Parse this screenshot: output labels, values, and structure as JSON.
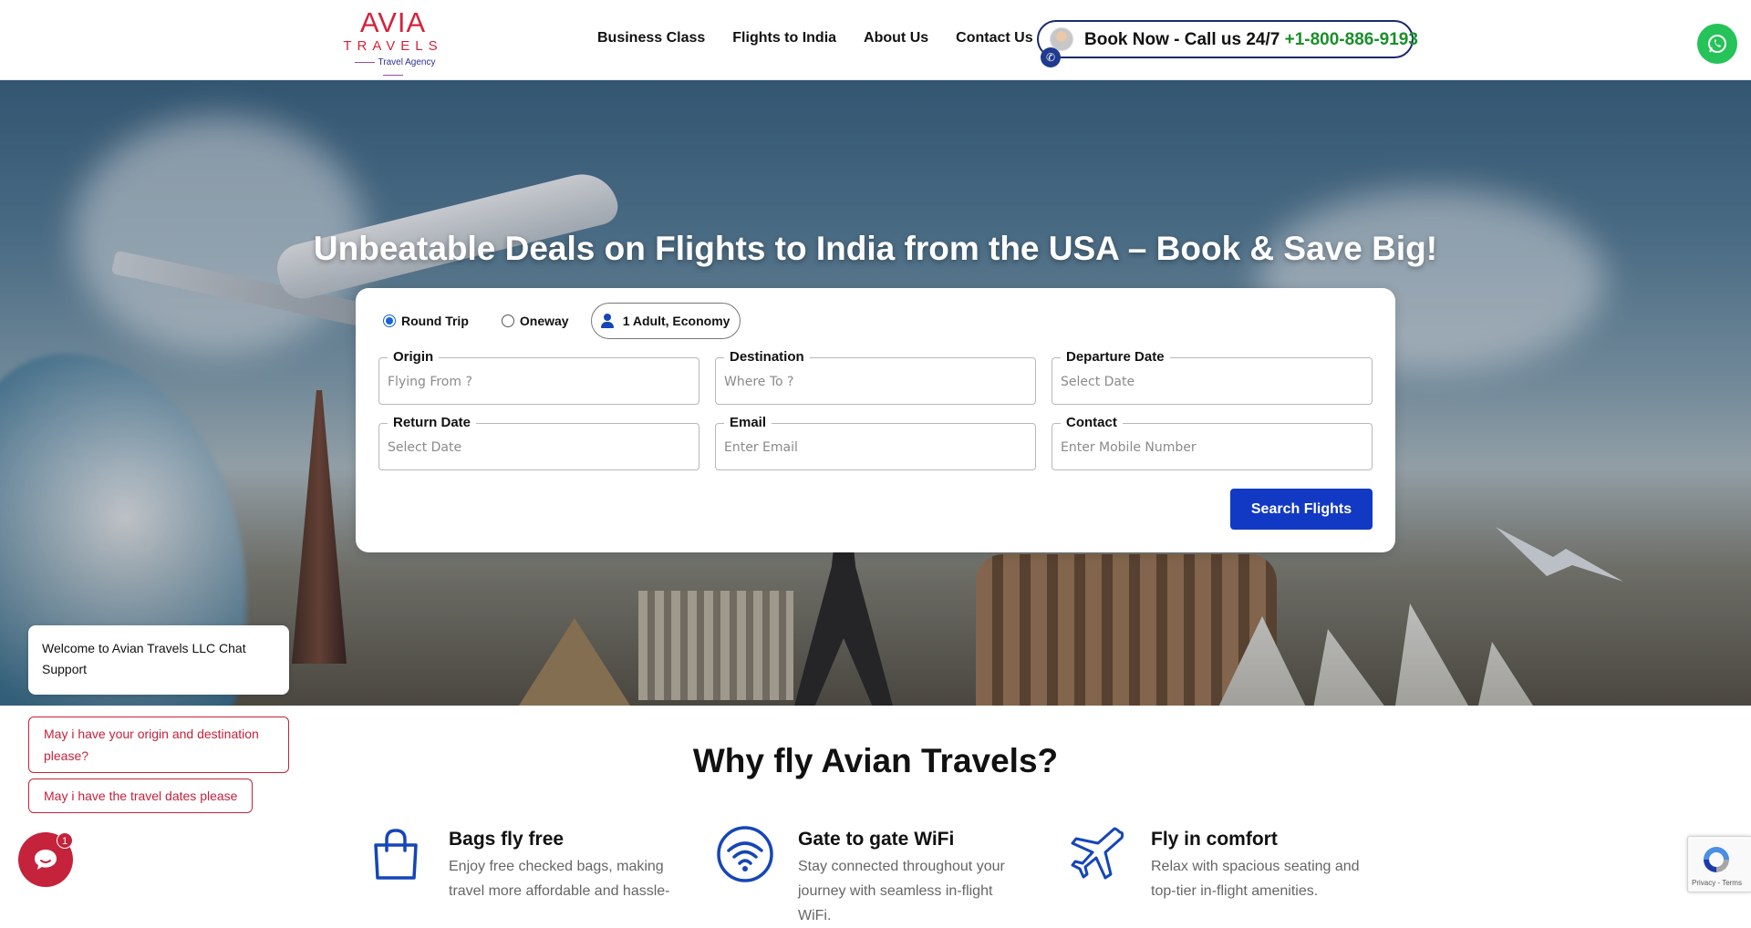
{
  "header": {
    "logo": {
      "line1": "AVIA",
      "line2": "TRAVELS",
      "line3": "Travel Agency"
    },
    "nav": [
      {
        "label": "Business Class"
      },
      {
        "label": "Flights to India"
      },
      {
        "label": "About Us"
      },
      {
        "label": "Contact Us"
      }
    ],
    "book_now": {
      "label": "Book Now - Call us 24/7",
      "phone": "+1-800-886-9193"
    },
    "whatsapp_icon": "whatsapp-icon",
    "colors": {
      "brand_red": "#d4233c",
      "brand_navy": "#1b2a6b",
      "phone_green": "#1a8f2a",
      "whatsapp_green": "#25c358"
    }
  },
  "hero": {
    "title": "Unbeatable Deals on Flights to India from the USA – Book & Save Big!"
  },
  "search": {
    "trip_types": [
      {
        "label": "Round Trip",
        "selected": true
      },
      {
        "label": "Oneway",
        "selected": false
      }
    ],
    "passengers": "1 Adult, Economy",
    "fields": {
      "origin": {
        "label": "Origin",
        "placeholder": "Flying From ?",
        "value": ""
      },
      "destination": {
        "label": "Destination",
        "placeholder": "Where To ?",
        "value": ""
      },
      "departure": {
        "label": "Departure Date",
        "placeholder": "Select Date",
        "value": ""
      },
      "return": {
        "label": "Return Date",
        "placeholder": "Select Date",
        "value": ""
      },
      "email": {
        "label": "Email",
        "placeholder": "Enter Email",
        "value": ""
      },
      "contact": {
        "label": "Contact",
        "placeholder": "Enter Mobile Number",
        "value": ""
      }
    },
    "submit_label": "Search Flights",
    "colors": {
      "accent": "#1239c4",
      "radio": "#1565d8"
    }
  },
  "why": {
    "title": "Why fly Avian Travels?",
    "features": [
      {
        "icon": "shopping-bag-icon",
        "title": "Bags fly free",
        "desc": "Enjoy free checked bags, making travel more affordable and hassle-"
      },
      {
        "icon": "wifi-icon",
        "title": "Gate to gate WiFi",
        "desc": "Stay connected throughout your journey with seamless in-flight WiFi."
      },
      {
        "icon": "airplane-icon",
        "title": "Fly in comfort",
        "desc": "Relax with spacious seating and top-tier in-flight amenities."
      }
    ]
  },
  "chat": {
    "welcome": "Welcome to Avian Travels LLC Chat Support",
    "suggestions": [
      "May i have your origin and destination please?",
      "May i have the travel dates please"
    ],
    "unread_count": "1",
    "launcher_icon": "chat-bubble-icon",
    "colors": {
      "chat_red": "#c5223b"
    }
  },
  "recaptcha": {
    "links": "Privacy - Terms"
  }
}
